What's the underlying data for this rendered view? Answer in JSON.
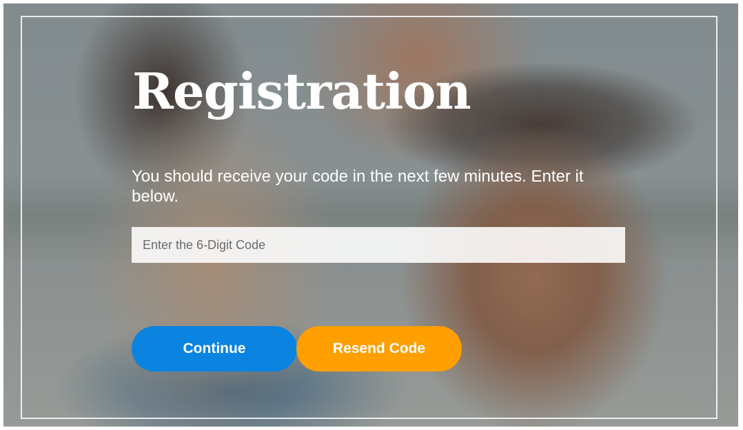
{
  "page": {
    "title": "Registration",
    "message": "You should receive your code in the next few minutes. Enter it below."
  },
  "form": {
    "code_input": {
      "placeholder": "Enter the 6-Digit Code",
      "value": ""
    }
  },
  "buttons": {
    "continue_label": "Continue",
    "resend_label": "Resend Code"
  },
  "colors": {
    "continue": "#0b83e0",
    "resend": "#ff9f00",
    "text": "#ffffff"
  }
}
